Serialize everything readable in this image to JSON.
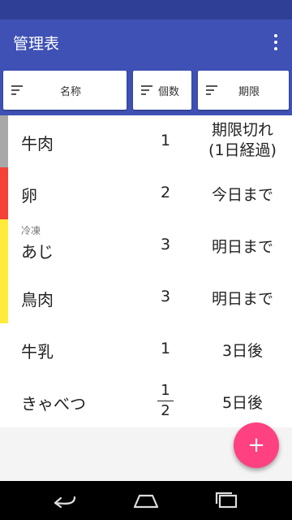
{
  "app": {
    "title": "管理表",
    "more_icon": "more-vert-icon"
  },
  "sort_buttons": [
    {
      "label": "名称",
      "icon": "sort-icon"
    },
    {
      "label": "個数",
      "icon": "sort-icon"
    },
    {
      "label": "期限",
      "icon": "sort-icon"
    }
  ],
  "items": [
    {
      "name": "牛肉",
      "note": "",
      "count": "1",
      "limit_line1": "期限切れ",
      "limit_line2": "(1日経過)",
      "status_color": "#a8a8a8"
    },
    {
      "name": "卵",
      "note": "",
      "count": "2",
      "limit_line1": "今日まで",
      "limit_line2": "",
      "status_color": "#f44336"
    },
    {
      "name": "あじ",
      "note": "冷凍",
      "count": "3",
      "limit_line1": "明日まで",
      "limit_line2": "",
      "status_color": "#ffeb3b"
    },
    {
      "name": "鳥肉",
      "note": "",
      "count": "3",
      "limit_line1": "明日まで",
      "limit_line2": "",
      "status_color": "#ffeb3b"
    },
    {
      "name": "牛乳",
      "note": "",
      "count": "1",
      "limit_line1": "3日後",
      "limit_line2": "",
      "status_color": "#ffffff"
    },
    {
      "name": "きゃべつ",
      "note": "",
      "count_numerator": "1",
      "count_denominator": "2",
      "limit_line1": "5日後",
      "limit_line2": "",
      "status_color": "#ffffff"
    }
  ],
  "fab": {
    "label": "+",
    "icon": "add-icon"
  },
  "navbar": {
    "icons": [
      "back-icon",
      "home-icon",
      "recents-icon"
    ]
  },
  "colors": {
    "primary": "#3f51b5",
    "primary_dark": "#2f3f95",
    "accent": "#ff4081"
  }
}
